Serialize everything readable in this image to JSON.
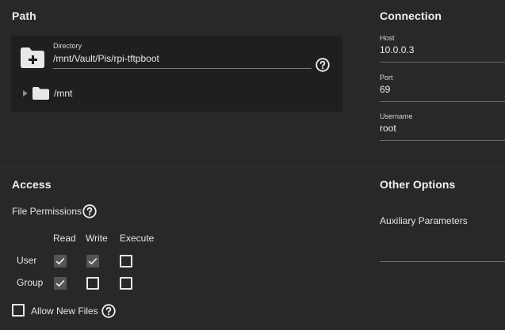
{
  "path": {
    "title": "Path",
    "directory_label": "Directory",
    "directory_value": "/mnt/Vault/Pis/rpi-tftpboot",
    "tree_item": "/mnt",
    "icons": {
      "add_folder": "folder-add-icon",
      "help": "help-circle-icon",
      "expand": "chevron-right-icon",
      "folder": "folder-icon"
    }
  },
  "connection": {
    "title": "Connection",
    "host_label": "Host",
    "host_value": "10.0.0.3",
    "port_label": "Port",
    "port_value": "69",
    "username_label": "Username",
    "username_value": "root"
  },
  "access": {
    "title": "Access",
    "file_permissions_label": "File Permissions",
    "columns": [
      "Read",
      "Write",
      "Execute"
    ],
    "rows": [
      {
        "label": "User",
        "read": true,
        "write": true,
        "execute": false
      },
      {
        "label": "Group",
        "read": true,
        "write": false,
        "execute": false
      }
    ],
    "allow_new_files_label": "Allow New Files",
    "allow_new_files_checked": false
  },
  "other_options": {
    "title": "Other Options",
    "auxiliary_parameters_label": "Auxiliary Parameters",
    "auxiliary_parameters_value": ""
  },
  "colors": {
    "background": "#282828",
    "card": "#1f1f1f",
    "text": "#e6e6e6",
    "checkbox_checked": "#545454"
  }
}
